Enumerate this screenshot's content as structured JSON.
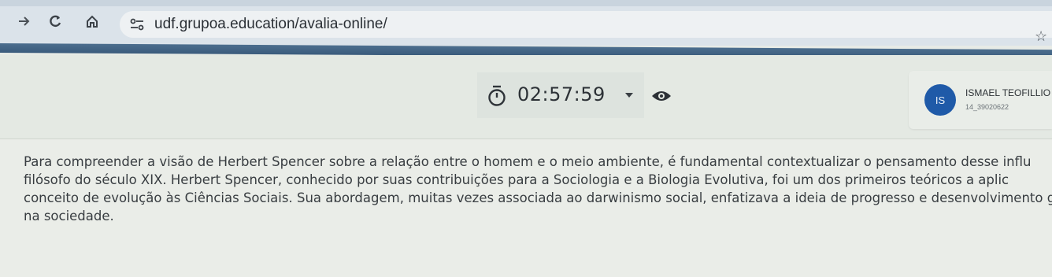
{
  "browser": {
    "url": "udf.grupoa.education/avalia-online/",
    "icons": [
      "forward-icon",
      "reload-icon",
      "home-icon",
      "site-settings-icon",
      "bookmark-star-icon"
    ]
  },
  "exam": {
    "timer": "02:57:59",
    "timer_icon": "stopwatch-icon",
    "visibility_icon": "eye-icon"
  },
  "user": {
    "initials": "IS",
    "name": "ISMAEL TEOFILLIO",
    "id": "14_39020622"
  },
  "question": {
    "lines": [
      "Para compreender a visão de Herbert Spencer sobre a relação entre o homem e o meio ambiente, é fundamental contextualizar o pensamento desse influ",
      "filósofo do século XIX. Herbert Spencer, conhecido por suas contribuições para a Sociologia e a Biologia Evolutiva, foi um dos primeiros teóricos a aplic",
      "conceito de evolução às Ciências Sociais. Sua abordagem, muitas vezes associada ao darwinismo social, enfatizava a ideia de progresso e desenvolvimento gra",
      "na sociedade."
    ]
  },
  "colors": {
    "accent": "#3a5b7c",
    "avatar": "#1f5aa8",
    "background": "#e7ebe6"
  }
}
